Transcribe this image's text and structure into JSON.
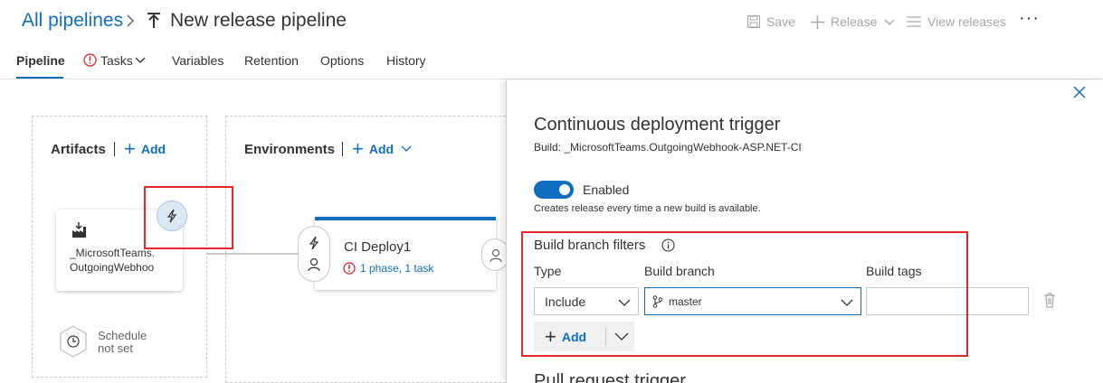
{
  "header": {
    "breadcrumb_root": "All pipelines",
    "title": "New release pipeline",
    "save_label": "Save",
    "release_label": "Release",
    "view_releases_label": "View releases",
    "more_label": "···"
  },
  "tabs": [
    {
      "label": "Pipeline",
      "active": true
    },
    {
      "label": "Tasks",
      "has_warning": true
    },
    {
      "label": "Variables"
    },
    {
      "label": "Retention"
    },
    {
      "label": "Options"
    },
    {
      "label": "History"
    }
  ],
  "canvas": {
    "artifacts_title": "Artifacts",
    "artifacts_add": "Add",
    "environments_title": "Environments",
    "environments_add": "Add",
    "artifact_line1": "_MicrosoftTeams.",
    "artifact_line2": "OutgoingWebhoo",
    "schedule_line1": "Schedule",
    "schedule_line2": "not set",
    "env_name": "CI Deploy1",
    "env_sub": "1 phase, 1 task"
  },
  "panel": {
    "title": "Continuous deployment trigger",
    "subtitle": "Build: _MicrosoftTeams.OutgoingWebhook-ASP.NET-CI",
    "toggle_label": "Enabled",
    "toggle_on": true,
    "toggle_desc": "Creates release every time a new build is available.",
    "filters_title": "Build branch filters",
    "col_type": "Type",
    "col_branch": "Build branch",
    "col_tags": "Build tags",
    "type_value": "Include",
    "branch_value": "master",
    "tags_value": "",
    "add_label": "Add",
    "next_section": "Pull request trigger"
  },
  "colors": {
    "accent": "#106ebe",
    "highlight": "#e8252a",
    "warning": "#e81123"
  }
}
